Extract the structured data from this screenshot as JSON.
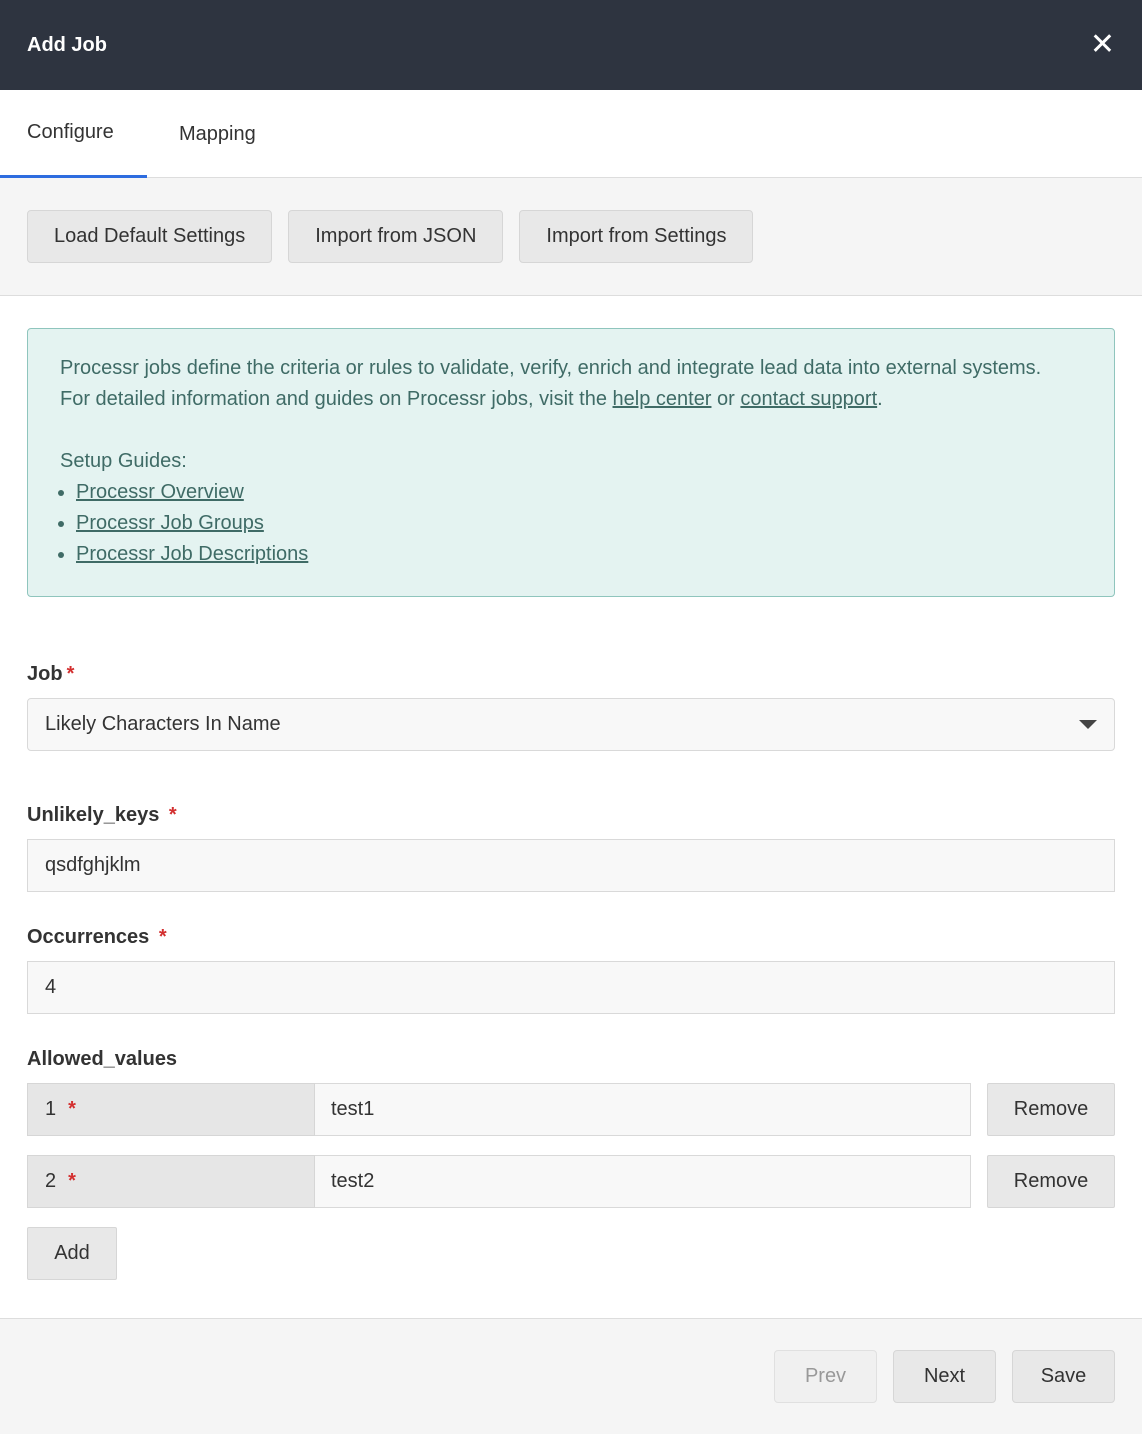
{
  "header": {
    "title": "Add Job",
    "close_icon": "close-icon"
  },
  "tabs": [
    {
      "label": "Configure",
      "active": true
    },
    {
      "label": "Mapping",
      "active": false
    }
  ],
  "toolbar": {
    "load_default": "Load Default Settings",
    "import_json": "Import from JSON",
    "import_settings": "Import from Settings"
  },
  "info": {
    "line1": "Processr jobs define the criteria or rules to validate, verify, enrich and integrate lead data into external systems.",
    "line2_prefix": "For detailed information and guides on Processr jobs, visit the ",
    "help_center": "help center",
    "or": " or ",
    "contact_support": "contact support",
    "period": ".",
    "guides_title": "Setup Guides:",
    "guides": [
      "Processr Overview",
      "Processr Job Groups",
      "Processr Job Descriptions"
    ]
  },
  "form": {
    "job": {
      "label": "Job",
      "required_mark": "*",
      "value": "Likely Characters In Name"
    },
    "unlikely_keys": {
      "label": "Unlikely_keys",
      "required_mark": "*",
      "value": "qsdfghjklm"
    },
    "occurrences": {
      "label": "Occurrences",
      "required_mark": "*",
      "value": "4"
    },
    "allowed_values": {
      "label": "Allowed_values",
      "rows": [
        {
          "key": "1",
          "required_mark": "*",
          "value": "test1",
          "remove": "Remove"
        },
        {
          "key": "2",
          "required_mark": "*",
          "value": "test2",
          "remove": "Remove"
        }
      ],
      "add": "Add"
    }
  },
  "footer": {
    "prev": "Prev",
    "next": "Next",
    "save": "Save",
    "prev_disabled": true
  },
  "colors": {
    "header_bg": "#2e3440",
    "tab_accent": "#2d6cdf",
    "info_bg": "#e4f3f1",
    "required": "#d32f2f"
  }
}
